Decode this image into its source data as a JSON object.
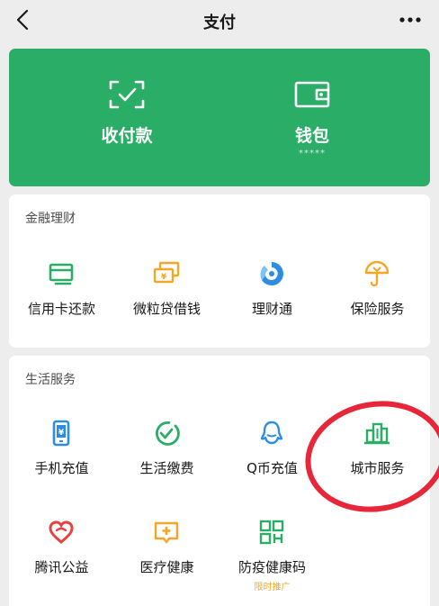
{
  "header": {
    "title": "支付",
    "back_icon": "chevron-left-icon",
    "more_icon": "more-dots-icon"
  },
  "hero": {
    "items": [
      {
        "label": "收付款",
        "icon": "scan-pay-icon"
      },
      {
        "label": "钱包",
        "sub": "*****",
        "icon": "wallet-icon"
      }
    ]
  },
  "finance": {
    "title": "金融理财",
    "items": [
      {
        "label": "信用卡还款",
        "icon": "credit-card-icon",
        "color": "#2aae67"
      },
      {
        "label": "微粒贷借钱",
        "icon": "loan-bills-icon",
        "color": "#f5a623"
      },
      {
        "label": "理财通",
        "icon": "wealth-icon",
        "color": "#2f8ce3"
      },
      {
        "label": "保险服务",
        "icon": "insurance-umbrella-icon",
        "color": "#f5a623"
      }
    ]
  },
  "life": {
    "title": "生活服务",
    "items": [
      {
        "label": "手机充值",
        "icon": "mobile-recharge-icon",
        "color": "#2f8ce3"
      },
      {
        "label": "生活缴费",
        "icon": "utilities-check-icon",
        "color": "#2aae67"
      },
      {
        "label": "Q币充值",
        "icon": "qq-coin-icon",
        "color": "#2f8ce3"
      },
      {
        "label": "城市服务",
        "icon": "city-buildings-icon",
        "color": "#2aae67"
      },
      {
        "label": "腾讯公益",
        "icon": "charity-heart-icon",
        "color": "#e64340"
      },
      {
        "label": "医疗健康",
        "icon": "medical-cross-icon",
        "color": "#f5a623"
      },
      {
        "label": "防疫健康码",
        "tag": "限时推广",
        "icon": "health-qr-code-icon",
        "color": "#2aae67"
      }
    ]
  },
  "annotation": {
    "color": "#e8263a"
  }
}
